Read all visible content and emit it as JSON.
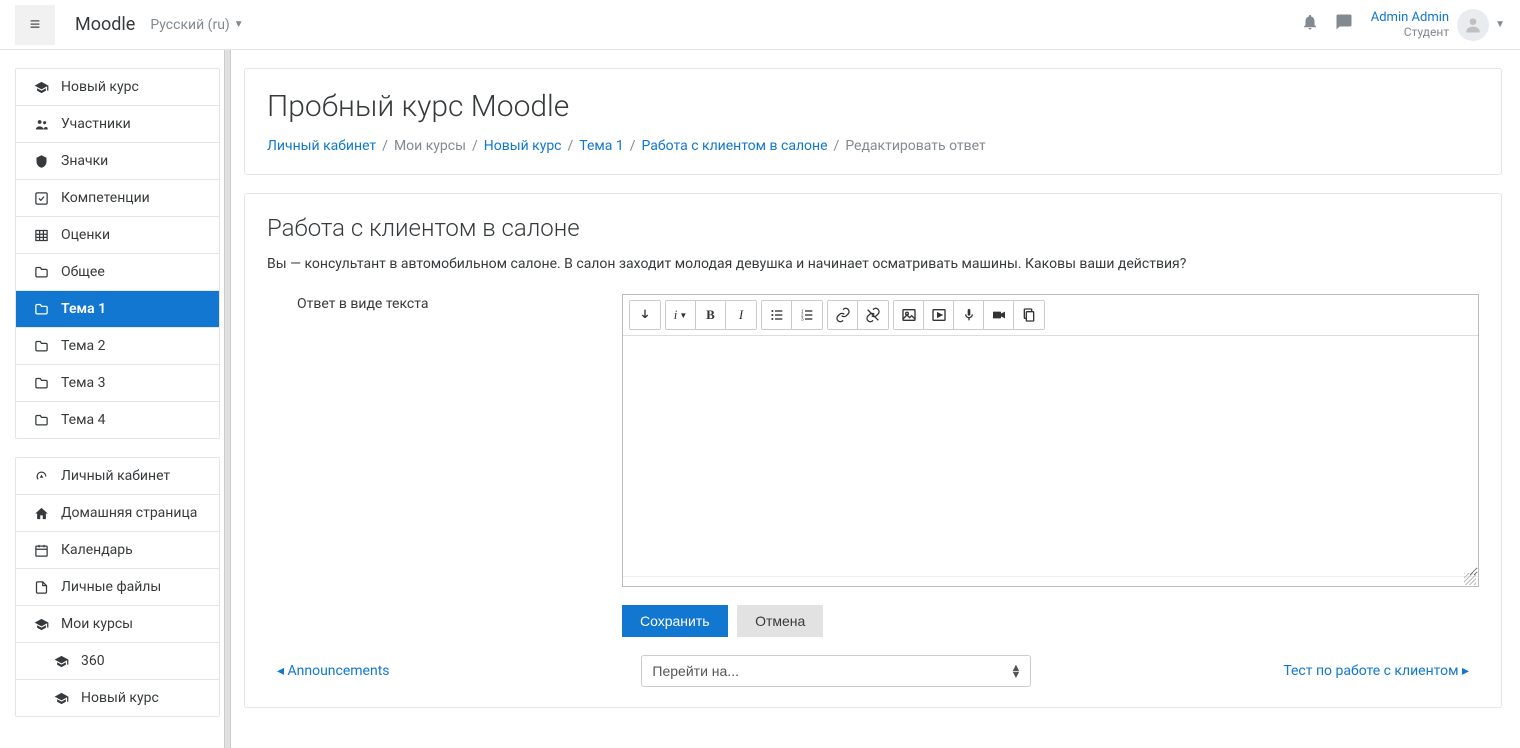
{
  "navbar": {
    "brand": "Moodle",
    "language": "Русский (ru)",
    "user_name": "Admin Admin",
    "user_role": "Студент"
  },
  "sidebar": {
    "section1": [
      {
        "icon": "graduation",
        "label": "Новый курс"
      },
      {
        "icon": "users",
        "label": "Участники"
      },
      {
        "icon": "shield",
        "label": "Значки"
      },
      {
        "icon": "check-square",
        "label": "Компетенции"
      },
      {
        "icon": "table",
        "label": "Оценки"
      },
      {
        "icon": "folder",
        "label": "Общее"
      },
      {
        "icon": "folder",
        "label": "Тема 1",
        "active": true
      },
      {
        "icon": "folder",
        "label": "Тема 2"
      },
      {
        "icon": "folder",
        "label": "Тема 3"
      },
      {
        "icon": "folder",
        "label": "Тема 4"
      }
    ],
    "section2": [
      {
        "icon": "speed",
        "label": "Личный кабинет"
      },
      {
        "icon": "home",
        "label": "Домашняя страница"
      },
      {
        "icon": "calendar",
        "label": "Календарь"
      },
      {
        "icon": "file",
        "label": "Личные файлы"
      },
      {
        "icon": "graduation",
        "label": "Мои курсы"
      },
      {
        "icon": "graduation",
        "label": "360",
        "indent": true
      },
      {
        "icon": "graduation",
        "label": "Новый курс",
        "indent": true
      }
    ]
  },
  "header": {
    "title": "Пробный курс Moodle",
    "breadcrumb": [
      {
        "text": "Личный кабинет",
        "link": true
      },
      {
        "text": "Мои курсы",
        "link": false
      },
      {
        "text": "Новый курс",
        "link": true
      },
      {
        "text": "Тема 1",
        "link": true
      },
      {
        "text": "Работа с клиентом в салоне",
        "link": true
      },
      {
        "text": "Редактировать ответ",
        "link": false
      }
    ]
  },
  "activity": {
    "title": "Работа с клиентом в салоне",
    "description": "Вы — консультант в автомобильном салоне. В салон заходит молодая девушка и начинает осматривать машины. Каковы ваши действия?",
    "field_label": "Ответ в виде текста",
    "save_btn": "Сохранить",
    "cancel_btn": "Отмена"
  },
  "nav_activity": {
    "prev": "Announcements",
    "jump_placeholder": "Перейти на...",
    "next": "Тест по работе с клиентом"
  }
}
